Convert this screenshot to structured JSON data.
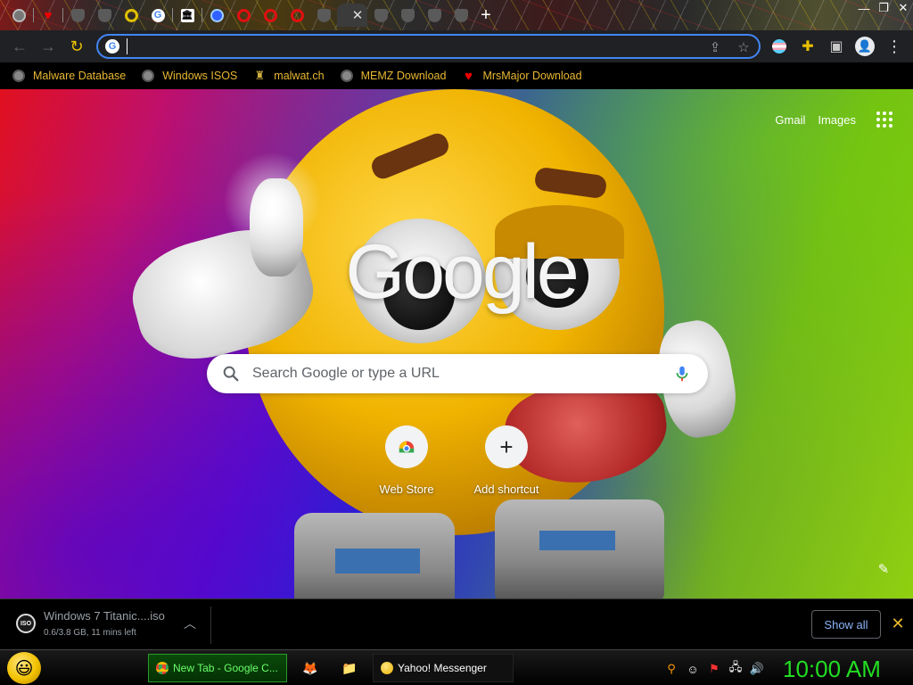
{
  "window": {
    "minimize_glyph": "—",
    "maximize_glyph": "❐",
    "close_glyph": "✕"
  },
  "tabs": {
    "close_glyph": "✕",
    "new_tab_glyph": "+",
    "favicons": [
      "globe-favicon",
      "heart-favicon",
      "shield-favicon",
      "shield-favicon",
      "yellow-ring-favicon",
      "google-favicon",
      "museum-favicon",
      "blue-favicon",
      "red-ring-favicon",
      "red-ring-favicon",
      "red-ring-favicon",
      "shield-favicon",
      "active-tab",
      "shield-favicon",
      "shield-favicon",
      "shield-favicon",
      "shield-favicon"
    ],
    "google_letter": "G",
    "museum_glyph": "🏛"
  },
  "toolbar": {
    "back_glyph": "←",
    "forward_glyph": "→",
    "reload_glyph": "↻",
    "omnibox_value": "",
    "omnibox_g": "G",
    "share_glyph": "⇪",
    "star_glyph": "☆",
    "extensions_glyph": "✚",
    "sidepanel_glyph": "▣",
    "avatar_glyph": "👤"
  },
  "bookmarks": [
    {
      "label": "Malware Database",
      "icon": "globe-icon"
    },
    {
      "label": "Windows ISOS",
      "icon": "globe-icon"
    },
    {
      "label": "malwat.ch",
      "icon": "man-icon"
    },
    {
      "label": "MEMZ Download",
      "icon": "globe-icon"
    },
    {
      "label": "MrsMajor Download",
      "icon": "heart-icon"
    }
  ],
  "ntp": {
    "gmail": "Gmail",
    "images": "Images",
    "logo": "Google",
    "search_placeholder": "Search Google or type a URL",
    "shortcuts": [
      {
        "label": "Web Store",
        "icon": "web-store-icon"
      },
      {
        "label": "Add shortcut",
        "icon": "plus-icon",
        "glyph": "+"
      }
    ],
    "pencil_glyph": "✎"
  },
  "download": {
    "icon_text": "ISO",
    "filename": "Windows 7 Titanic....iso",
    "status": "0.6/3.8 GB, 11 mins left",
    "chevron": "︿",
    "show_all": "Show all",
    "close_glyph": "✕"
  },
  "taskbar": {
    "start_glyph": "😃",
    "tasks": [
      {
        "label": "New Tab - Google C...",
        "icon": "chrome-icon",
        "active": true
      },
      {
        "label": "Yahoo! Messenger",
        "icon": "yahoo-messenger-icon",
        "active": false
      }
    ],
    "firefox_glyph": "🦊",
    "folder_glyph": "📁",
    "tray_search": "⚲",
    "tray_msg": "☺",
    "tray_flag": "⚑",
    "tray_network": "🖧",
    "tray_volume": "🔊",
    "clock": "10:00 AM"
  },
  "colors": {
    "accent_blue": "#4285f4",
    "bookmark_text": "#e8b830",
    "clock_green": "#22dd22",
    "show_all_text": "#8ab4f8"
  }
}
